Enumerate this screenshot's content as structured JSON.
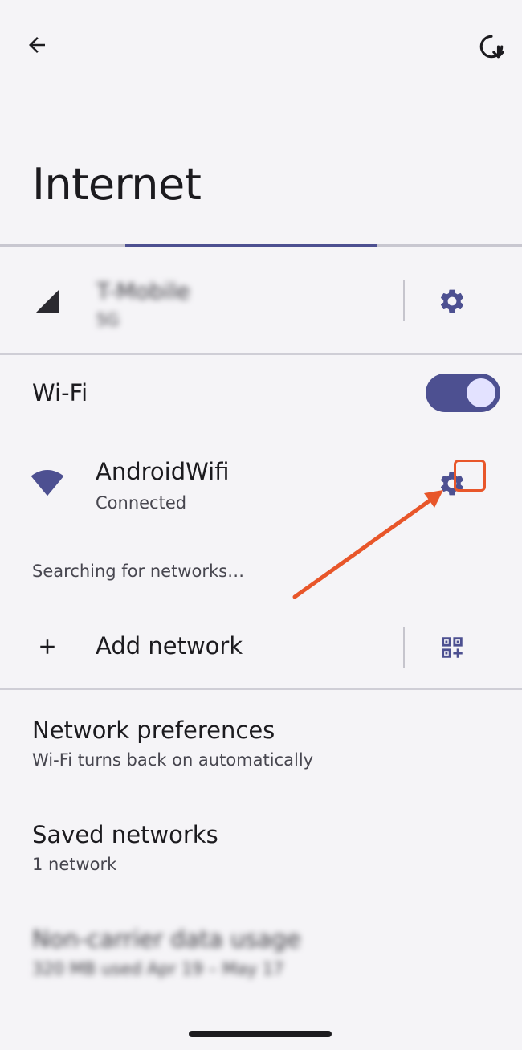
{
  "page_title": "Internet",
  "mobile": {
    "carrier": "T-Mobile",
    "type": "5G"
  },
  "wifi": {
    "label": "Wi-Fi",
    "enabled": true,
    "connected_network": {
      "name": "AndroidWifi",
      "status": "Connected"
    },
    "searching_text": "Searching for networks…"
  },
  "add_network": {
    "label": "Add network"
  },
  "network_preferences": {
    "title": "Network preferences",
    "subtitle": "Wi-Fi turns back on automatically"
  },
  "saved_networks": {
    "title": "Saved networks",
    "subtitle": "1 network"
  },
  "data_usage": {
    "title": "Non-carrier data usage",
    "subtitle": "320 MB used Apr 19 – May 17"
  },
  "icons": {
    "back": "arrow-back-icon",
    "refresh": "refresh-icon",
    "signal": "cell-signal-icon",
    "settings": "gear-icon",
    "wifi": "wifi-icon",
    "add": "plus-icon",
    "qr": "qr-code-scan-icon"
  },
  "colors": {
    "accent": "#4d5091",
    "annotation": "#e8562a",
    "background": "#f5f4f7"
  }
}
